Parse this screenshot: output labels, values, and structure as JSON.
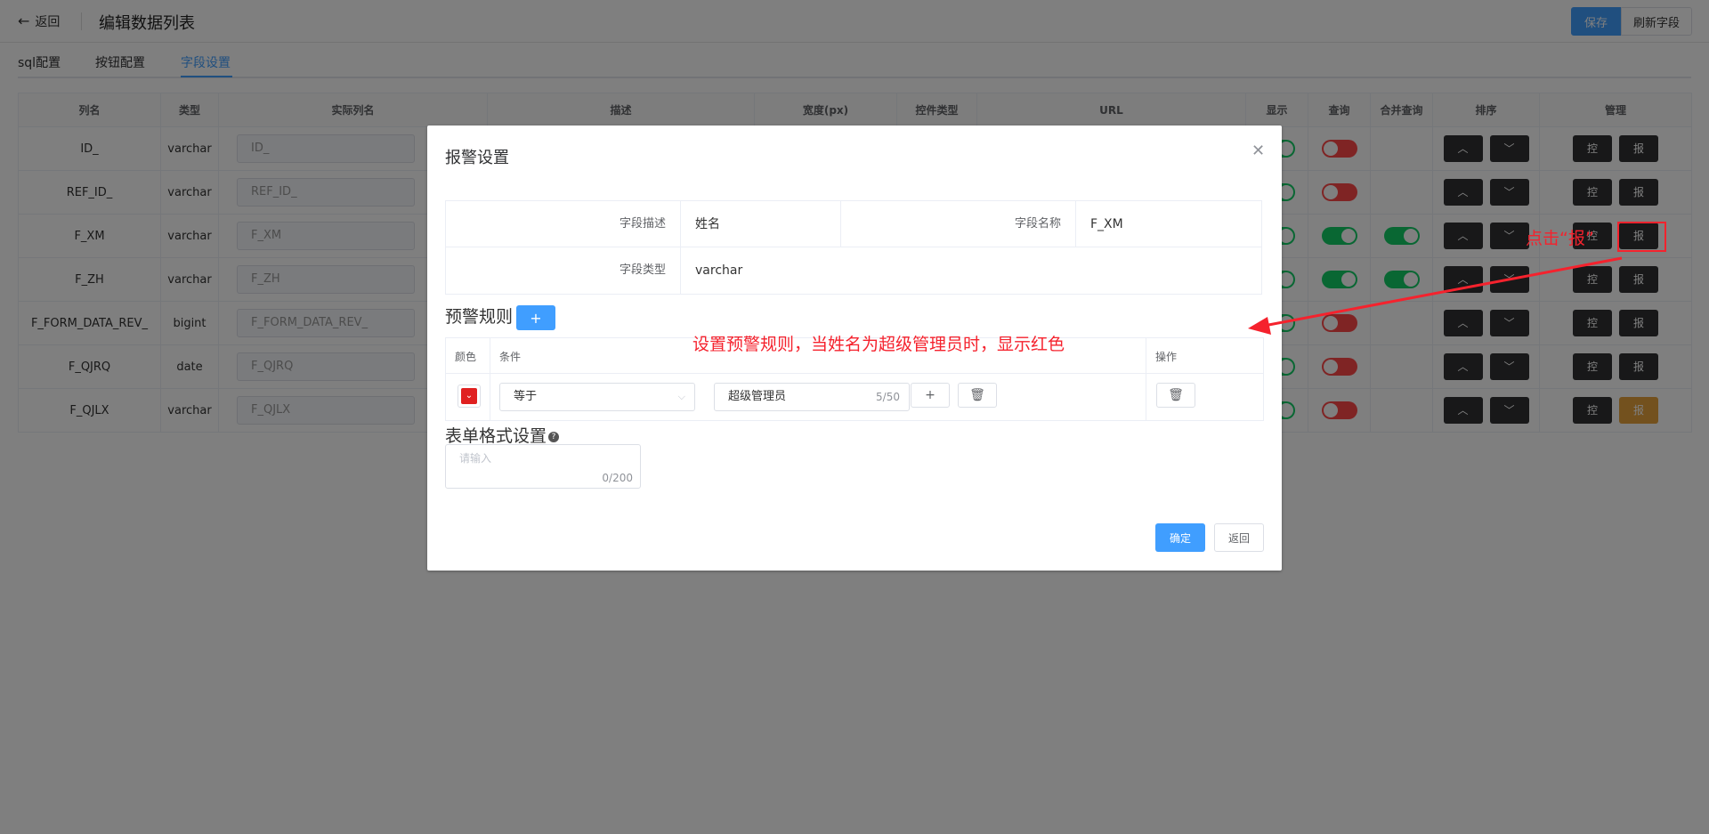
{
  "header": {
    "back_label": "返回",
    "title": "编辑数据列表",
    "save_label": "保存",
    "refresh_label": "刷新字段"
  },
  "tabs": [
    "sql配置",
    "按钮配置",
    "字段设置"
  ],
  "active_tab": "字段设置",
  "grid": {
    "columns": [
      "列名",
      "类型",
      "实际列名",
      "描述",
      "宽度(px)",
      "控件类型",
      "URL",
      "显示",
      "查询",
      "合并查询",
      "排序",
      "管理"
    ],
    "rows": [
      {
        "name": "ID_",
        "type": "varchar",
        "actual": "ID_",
        "query": "off",
        "merge": "",
        "report_highlight": false
      },
      {
        "name": "REF_ID_",
        "type": "varchar",
        "actual": "REF_ID_",
        "query": "off",
        "merge": "",
        "report_highlight": false
      },
      {
        "name": "F_XM",
        "type": "varchar",
        "actual": "F_XM",
        "query": "on",
        "merge": "on",
        "report_highlight": false
      },
      {
        "name": "F_ZH",
        "type": "varchar",
        "actual": "F_ZH",
        "query": "on",
        "merge": "on",
        "report_highlight": false
      },
      {
        "name": "F_FORM_DATA_REV_",
        "type": "bigint",
        "actual": "F_FORM_DATA_REV_",
        "query": "off",
        "merge": "",
        "report_highlight": false
      },
      {
        "name": "F_QJRQ",
        "type": "date",
        "actual": "F_QJRQ",
        "query": "off",
        "merge": "",
        "report_highlight": false
      },
      {
        "name": "F_QJLX",
        "type": "varchar",
        "actual": "F_QJLX",
        "query": "off",
        "merge": "",
        "report_highlight": true
      }
    ],
    "btn_control": "控",
    "btn_report": "报"
  },
  "dialog": {
    "title": "报警设置",
    "field_desc_label": "字段描述",
    "field_desc_value": "姓名",
    "field_name_label": "字段名称",
    "field_name_value": "F_XM",
    "field_type_label": "字段类型",
    "field_type_value": "varchar",
    "rules_title": "预警规则",
    "add_rule_icon": "+",
    "rule_headers": {
      "color": "颜色",
      "condition": "条件",
      "action": "操作"
    },
    "rule": {
      "color": "#e02020",
      "operator": "等于",
      "value": "超级管理员",
      "value_count": "5/50"
    },
    "form_format_title": "表单格式设置",
    "textarea_placeholder": "请输入",
    "textarea_count": "0/200",
    "ok_label": "确定",
    "back_label": "返回"
  },
  "annotations": {
    "click_hint": "点击“报”",
    "rule_hint": "设置预警规则，当姓名为超级管理员时，显示红色"
  }
}
